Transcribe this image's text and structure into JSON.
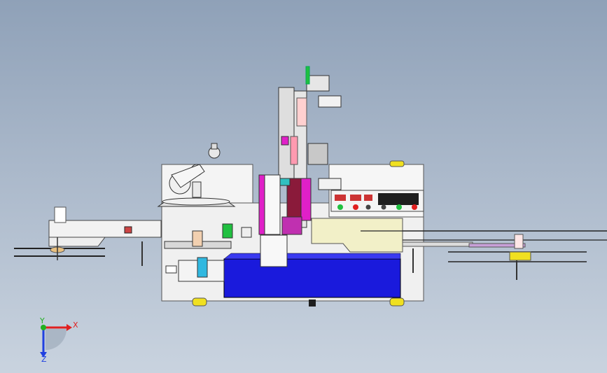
{
  "view": {
    "background_top": "#8fa1b8",
    "background_bottom": "#c9d3df"
  },
  "colors": {
    "frame_white": "#f4f4f4",
    "frame_edge": "#555555",
    "blue_tank": "#1a1adc",
    "yellow_plate": "#f2f0c8",
    "magenta": "#e020c8",
    "green": "#20c040",
    "cyan": "#30b8e0",
    "red_lamp": "#e02020",
    "yellow_roller": "#f0e020",
    "dark": "#1e1e1e"
  },
  "triad": {
    "x_label": "X",
    "y_label": "Y",
    "z_label": "Z",
    "x_color": "#e02020",
    "y_color": "#20b020",
    "z_color": "#2040e0"
  }
}
